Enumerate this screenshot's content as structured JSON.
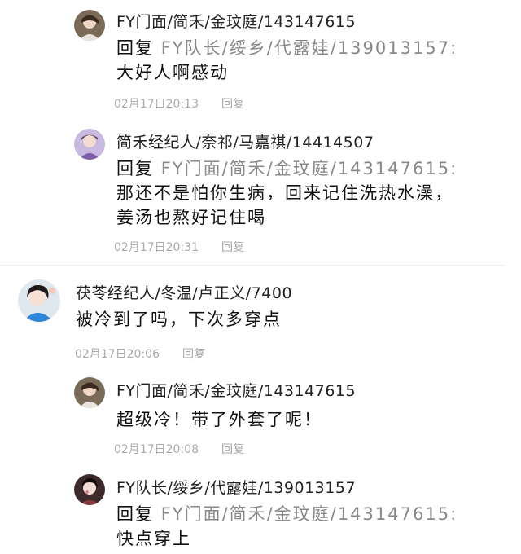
{
  "comments": [
    {
      "name": "FY门面/简禾/金玟庭/143147615",
      "reply_prefix": "回复 ",
      "reply_target": "FY队长/绥乡/代露娃/139013157:",
      "text": "大好人啊感动",
      "time": "02月17日20:13",
      "reply_label": "回复"
    },
    {
      "name": "简禾经纪人/奈祁/马嘉祺/14414507",
      "reply_prefix": "回复 ",
      "reply_target": "FY门面/简禾/金玟庭/143147615:",
      "text": "那还不是怕你生病，回来记住洗热水澡，姜汤也熬好记住喝",
      "time": "02月17日20:31",
      "reply_label": "回复"
    },
    {
      "name": "茯苓经纪人/冬温/卢正义/7400",
      "text": "被冷到了吗，下次多穿点",
      "time": "02月17日20:06",
      "reply_label": "回复"
    },
    {
      "name": "FY门面/简禾/金玟庭/143147615",
      "text": "超级冷！带了外套了呢！",
      "time": "02月17日20:08",
      "reply_label": "回复"
    },
    {
      "name": "FY队长/绥乡/代露娃/139013157",
      "reply_prefix": "回复 ",
      "reply_target": "FY门面/简禾/金玟庭/143147615:",
      "text": "快点穿上"
    }
  ],
  "colors": {
    "meta_text": "#aaaaaa",
    "reply_target": "#888888",
    "divider": "#ececec"
  }
}
